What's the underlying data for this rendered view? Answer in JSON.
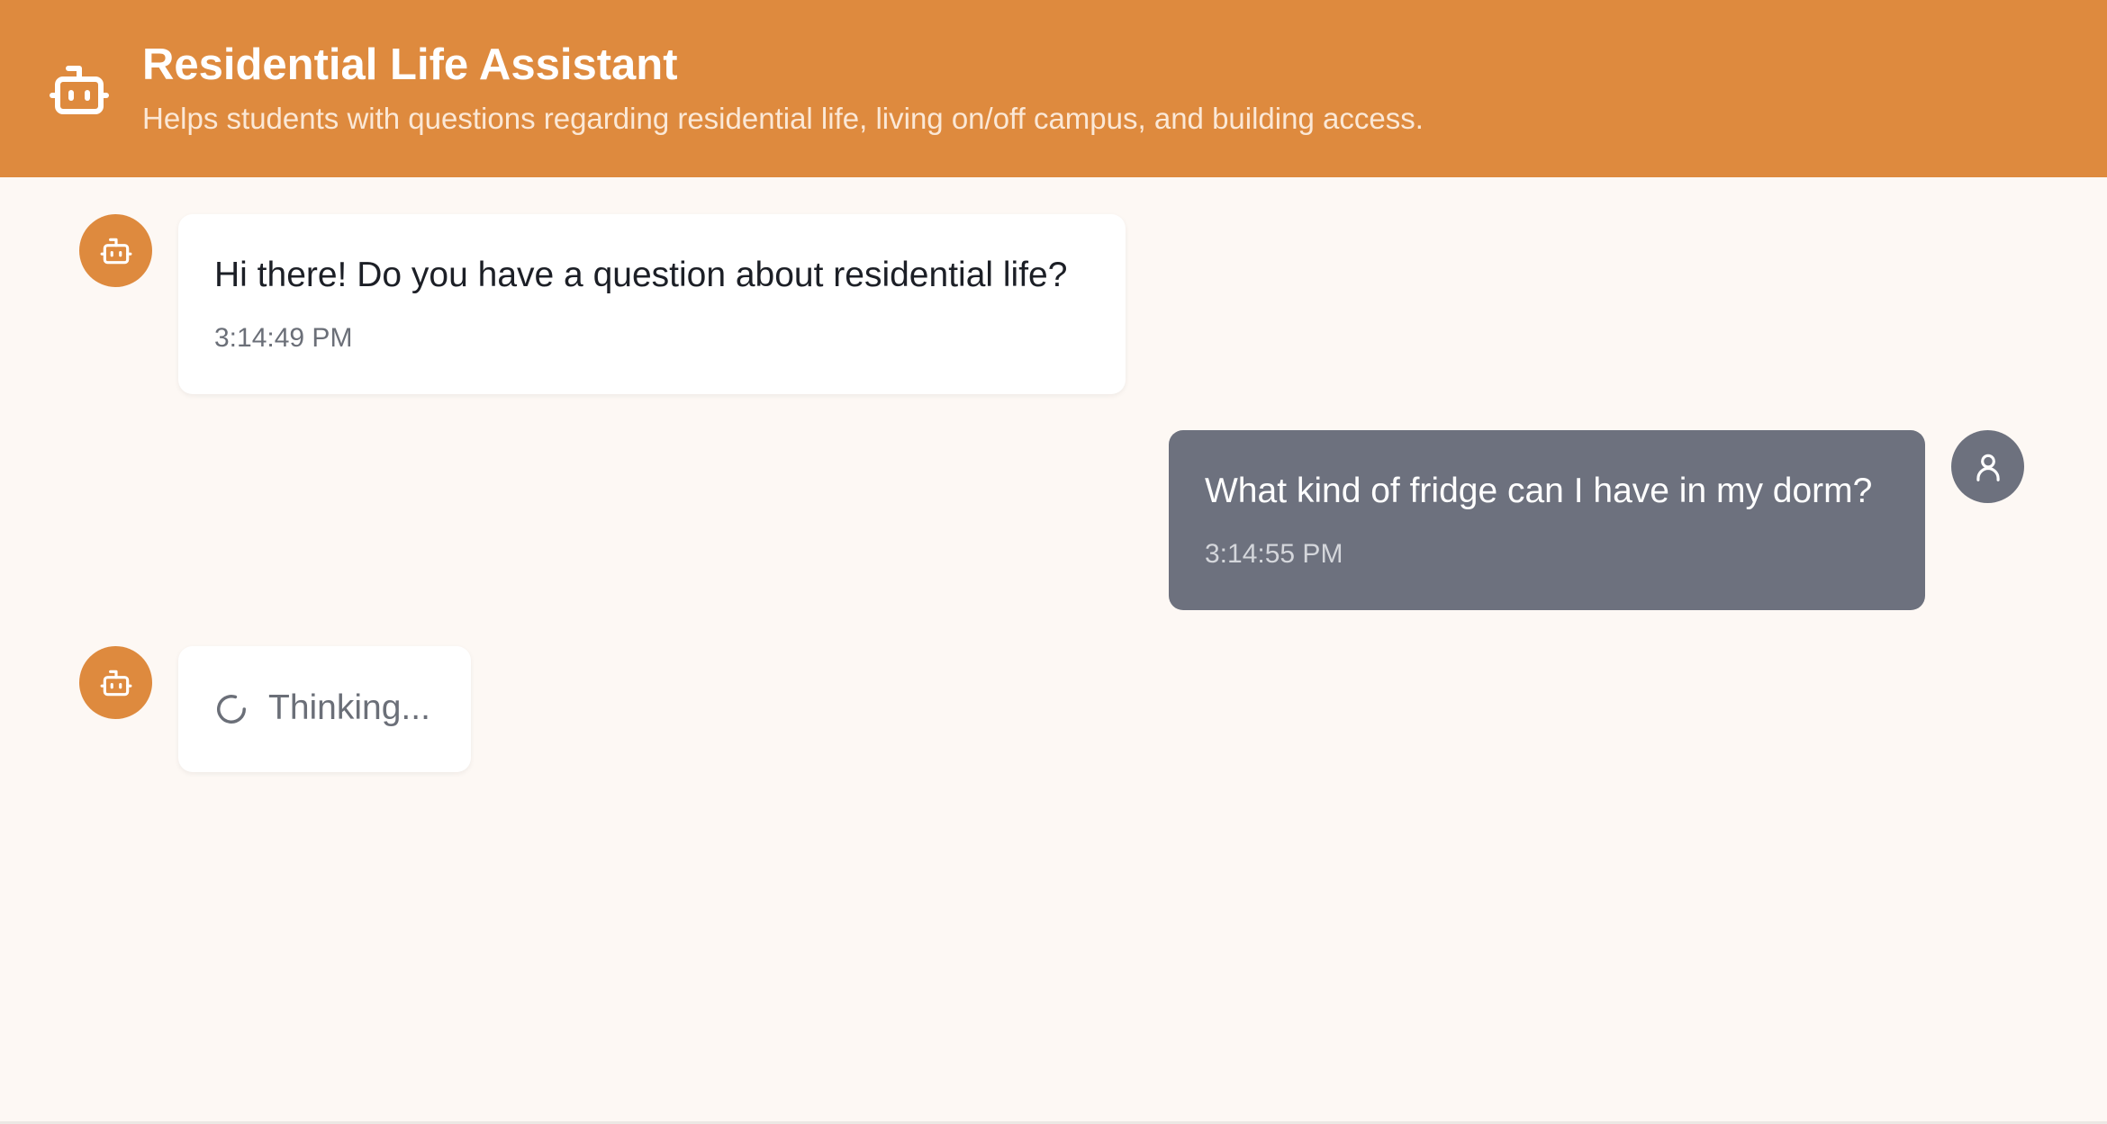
{
  "header": {
    "title": "Residential Life Assistant",
    "subtitle": "Helps students with questions regarding residential life, living on/off campus, and building access.",
    "icon": "bot-icon"
  },
  "messages": [
    {
      "role": "assistant",
      "text": "Hi there! Do you have a question about residential life?",
      "time": "3:14:49 PM",
      "avatar_icon": "bot-icon"
    },
    {
      "role": "user",
      "text": "What kind of fridge can I have in my dorm?",
      "time": "3:14:55 PM",
      "avatar_icon": "user-icon"
    }
  ],
  "pending": {
    "role": "assistant",
    "text": "Thinking...",
    "icon": "spinner-icon"
  },
  "colors": {
    "accent": "#de8a3e",
    "user_bubble": "#6d717e",
    "background": "#fdf8f4"
  }
}
